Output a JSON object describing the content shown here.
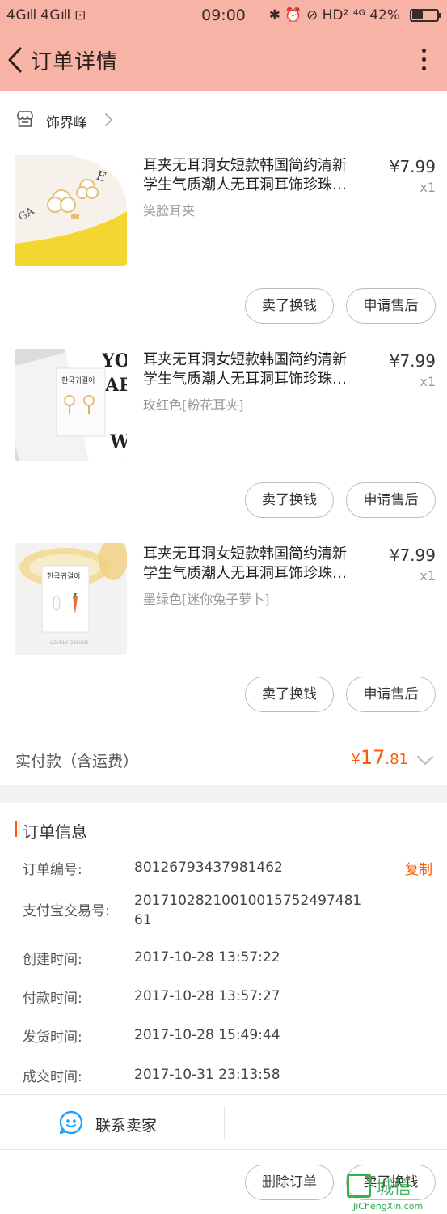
{
  "status_bar": {
    "left": "4G\tıll 4G ıll □",
    "time": "09:00",
    "right": "✱ ⏰ ∅ HD 4G 42%",
    "battery_level": 0.42
  },
  "header": {
    "title": "订单详情"
  },
  "shop": {
    "name": "饰界峰"
  },
  "items": [
    {
      "title_line1": "耳夹无耳洞女短款韩国简约清新",
      "title_line2": "学生气质潮人无耳洞耳饰珍珠…",
      "sku": "笑脸耳夹",
      "price": "¥7.99",
      "qty": "x1",
      "btn_sell": "卖了换钱",
      "btn_after": "申请售后"
    },
    {
      "title_line1": "耳夹无耳洞女短款韩国简约清新",
      "title_line2": "学生气质潮人无耳洞耳饰珍珠…",
      "sku": "玫红色[粉花耳夹]",
      "price": "¥7.99",
      "qty": "x1",
      "btn_sell": "卖了换钱",
      "btn_after": "申请售后"
    },
    {
      "title_line1": "耳夹无耳洞女短款韩国简约清新",
      "title_line2": "学生气质潮人无耳洞耳饰珍珠…",
      "sku": "墨绿色[迷你兔子萝卜]",
      "price": "¥7.99",
      "qty": "x1",
      "btn_sell": "卖了换钱",
      "btn_after": "申请售后"
    }
  ],
  "total": {
    "label": "实付款（含运费）",
    "currency": "¥",
    "integer": "17",
    "decimal": ".81"
  },
  "order_info": {
    "title": "订单信息",
    "copy_label": "复制",
    "rows": [
      {
        "label": "订单编号:",
        "value": "80126793437981462"
      },
      {
        "label": "支付宝交易号:",
        "value": "20171028210010015752497481 61"
      },
      {
        "label": "创建时间:",
        "value": "2017-10-28 13:57:22"
      },
      {
        "label": "付款时间:",
        "value": "2017-10-28 13:57:27"
      },
      {
        "label": "发货时间:",
        "value": "2017-10-28 15:49:44"
      },
      {
        "label": "成交时间:",
        "value": "2017-10-31 23:13:58"
      }
    ]
  },
  "footer": {
    "contact_label": "联系卖家",
    "delete_label": "删除订单",
    "sell_label": "卖了换钱"
  },
  "watermark": {
    "text": "城信",
    "url": "JiChengXin.com"
  },
  "colors": {
    "header_bg": "#f7b3a6",
    "accent": "#ff5a00",
    "contact_icon": "#1aa3ff"
  }
}
